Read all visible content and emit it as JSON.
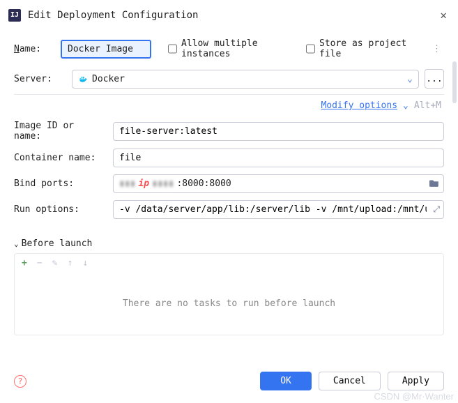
{
  "window": {
    "title": "Edit Deployment Configuration"
  },
  "topRow": {
    "nameLabel_pre": "N",
    "nameLabel_post": "ame:",
    "nameValue": "Docker Image",
    "allow_pre": "Allow m",
    "allow_ul": "u",
    "allow_post": "ltiple instances",
    "store_pre": "Store as pro",
    "store_ul": "j",
    "store_post": "ect file"
  },
  "server": {
    "label": "Server:",
    "value": "Docker",
    "ellipsis": "..."
  },
  "modify": {
    "label_pre": "",
    "label_ul": "M",
    "label_post": "odify options",
    "shortcut": "Alt+M"
  },
  "form": {
    "imageLabel": "Image ID or name:",
    "imageValue": "file-server:latest",
    "containerLabel": "Container name:",
    "containerValue": "file",
    "bindLabel": "Bind ports:",
    "bindMaskedPrefix": "▮▮▮",
    "bindIp": "ip",
    "bindMaskedMid": "▮▮▮▮",
    "bindSuffix": ":8000:8000",
    "runoptLabel": "Run options:",
    "runoptValue": "-v /data/server/app/lib:/server/lib -v /mnt/upload:/mnt/upload"
  },
  "beforeLaunch": {
    "header_ul": "B",
    "header_post": "efore launch",
    "add": "+",
    "remove": "−",
    "edit": "✎",
    "up": "↑",
    "down": "↓",
    "empty": "There are no tasks to run before launch"
  },
  "footer": {
    "ok": "OK",
    "cancel": "Cancel",
    "apply": "Apply",
    "help": "?"
  },
  "watermark": "CSDN @Mr·Wanter"
}
